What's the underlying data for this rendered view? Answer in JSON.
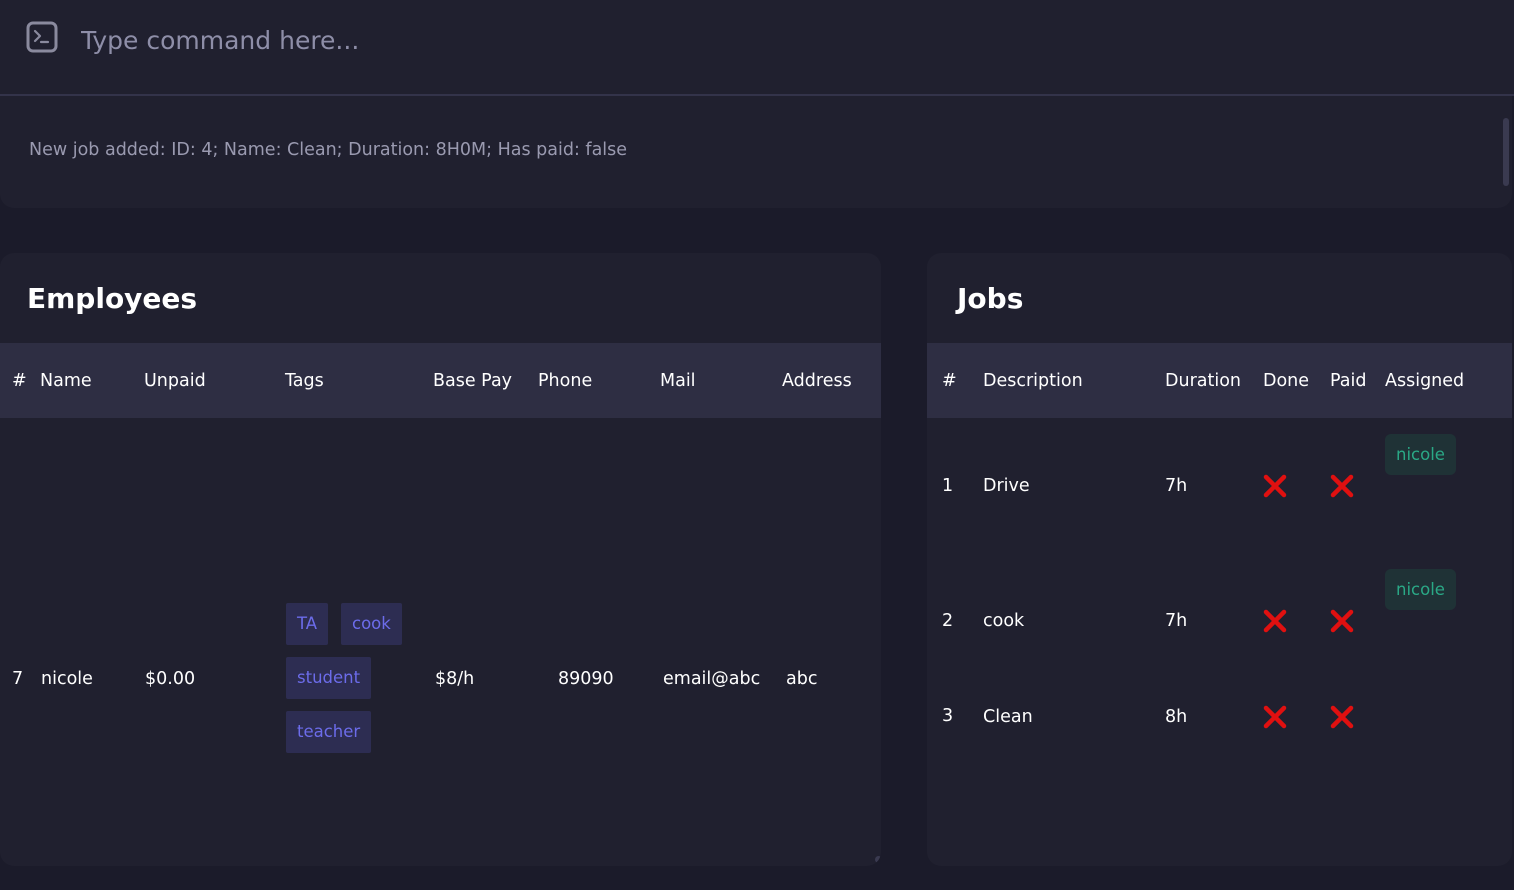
{
  "command": {
    "placeholder": "Type command here...",
    "icon": "terminal-icon"
  },
  "result": {
    "message": "New job added: ID: 4; Name: Clean; Duration: 8H0M; Has paid: false"
  },
  "employees": {
    "title": "Employees",
    "columns": [
      "#",
      "Name",
      "Unpaid",
      "Tags",
      "Base Pay",
      "Phone",
      "Mail",
      "Address"
    ],
    "rows": [
      {
        "index": "7",
        "name": "nicole",
        "unpaid": "$0.00",
        "tags": [
          "TA",
          "cook",
          "student",
          "teacher"
        ],
        "base_pay": "$8/h",
        "phone": "89090",
        "mail": "email@abc",
        "address": "abc"
      }
    ]
  },
  "jobs": {
    "title": "Jobs",
    "columns": [
      "#",
      "Description",
      "Duration",
      "Done",
      "Paid",
      "Assigned"
    ],
    "rows": [
      {
        "index": "1",
        "description": "Drive",
        "duration": "7h",
        "done": false,
        "paid": false,
        "assigned": "nicole"
      },
      {
        "index": "2",
        "description": "cook",
        "duration": "7h",
        "done": false,
        "paid": false,
        "assigned": "nicole"
      },
      {
        "index": "3",
        "description": "Clean",
        "duration": "8h",
        "done": false,
        "paid": false,
        "assigned": ""
      }
    ]
  },
  "colors": {
    "background": "#1b1b2a",
    "panel": "#20202f",
    "header_row": "#2e2e43",
    "tag_bg": "#2d2d52",
    "tag_text": "#6c6cea",
    "assigned_bg": "#1f3236",
    "assigned_text": "#2aa886",
    "cross": "#e01010"
  }
}
